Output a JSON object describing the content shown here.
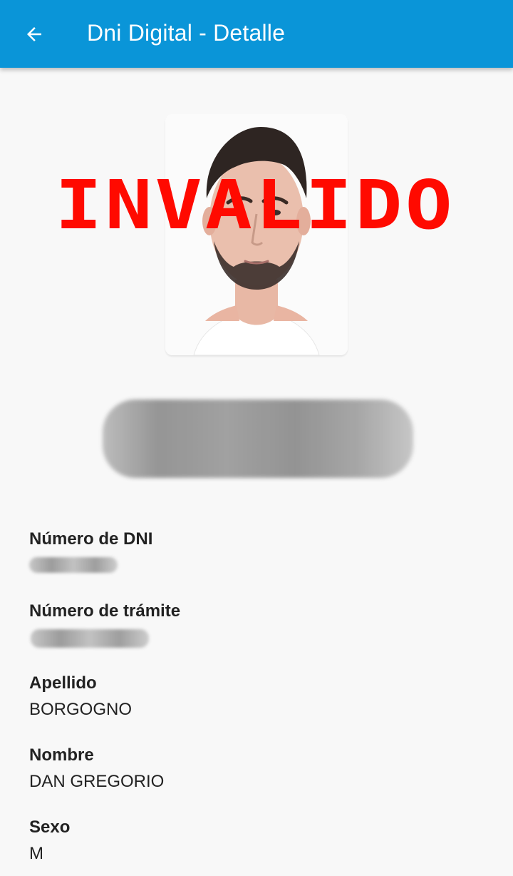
{
  "app_bar": {
    "title": "Dni Digital - Detalle",
    "back_icon": "arrow-left-icon",
    "background_color": "#0a95d8"
  },
  "photo": {
    "stamp_text": "INVALIDO",
    "stamp_color": "#ff0a00"
  },
  "fields": [
    {
      "label": "Número de DNI",
      "value": ""
    },
    {
      "label": "Número de trámite",
      "value": ""
    },
    {
      "label": "Apellido",
      "value": "BORGOGNO"
    },
    {
      "label": "Nombre",
      "value": "DAN GREGORIO"
    },
    {
      "label": "Sexo",
      "value": "M"
    }
  ]
}
